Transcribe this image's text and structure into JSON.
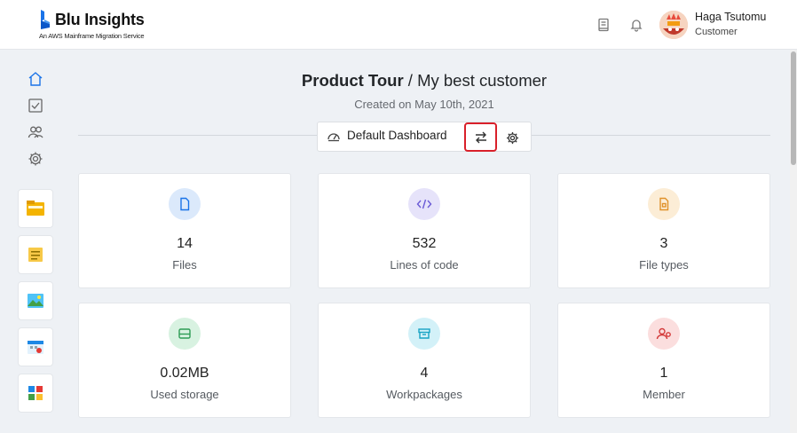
{
  "app": {
    "name": "Blu Insights",
    "tagline": "An AWS Mainframe Migration Service"
  },
  "user": {
    "name": "Haga Tsutomu",
    "role": "Customer"
  },
  "header": {
    "title_strong": "Product Tour",
    "title_rest": " / My best customer",
    "created": "Created on May 10th, 2021"
  },
  "toolbar": {
    "dashboard_label": "Default Dashboard"
  },
  "cards": [
    {
      "value": "14",
      "label": "Files",
      "icon": "file-icon",
      "color": "#1a73e8",
      "bg": "#dbe9fb"
    },
    {
      "value": "532",
      "label": "Lines of code",
      "icon": "code-icon",
      "color": "#6b5bd6",
      "bg": "#e6e3fa"
    },
    {
      "value": "3",
      "label": "File types",
      "icon": "file-type-icon",
      "color": "#e0912a",
      "bg": "#fcedd6"
    },
    {
      "value": "0.02MB",
      "label": "Used storage",
      "icon": "storage-icon",
      "color": "#2e9c55",
      "bg": "#d8f2e1"
    },
    {
      "value": "4",
      "label": "Workpackages",
      "icon": "workpackage-icon",
      "color": "#18a3c4",
      "bg": "#d3f1f8"
    },
    {
      "value": "1",
      "label": "Member",
      "icon": "member-icon",
      "color": "#d43c3c",
      "bg": "#fbdede"
    }
  ]
}
